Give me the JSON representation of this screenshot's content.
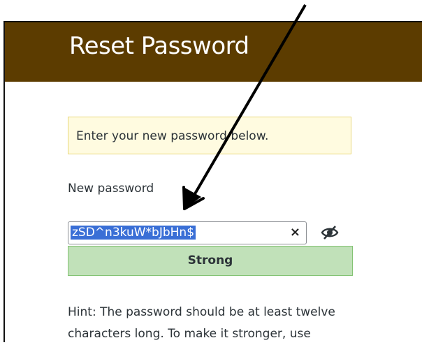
{
  "header": {
    "title": "Reset Password"
  },
  "message": {
    "text": "Enter your new password below."
  },
  "form": {
    "new_password_label": "New password",
    "password_value": "zSD^n3kuW*bJbHn$",
    "clear_symbol": "×",
    "strength_label": "Strong"
  },
  "hint": {
    "text": "Hint: The password should be at least twelve characters long. To make it stronger, use"
  },
  "colors": {
    "header_bg": "#5c3c00",
    "strength_bg": "#c1e1b9",
    "message_bg": "#fffbe0",
    "selection_bg": "#3a6fd6"
  },
  "icons": {
    "clear": "close-icon",
    "visibility": "eye-slash-icon",
    "annotation": "arrow-icon"
  }
}
